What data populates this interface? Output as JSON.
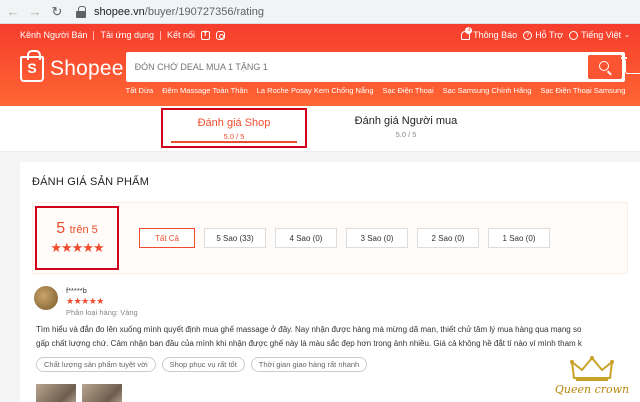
{
  "browser": {
    "domain": "shopee.vn",
    "path": "/buyer/190727356/rating"
  },
  "topbar": {
    "seller_center": "Kênh Người Bán",
    "download_app": "Tải ứng dụng",
    "connect": "Kết nối",
    "notifications": "Thông Báo",
    "notification_count": "3",
    "help": "Hỗ Trợ",
    "language": "Tiếng Việt"
  },
  "logo": {
    "brand": "Shopee",
    "mark": "S"
  },
  "search": {
    "placeholder": "ĐÓN CHỜ DEAL MUA 1 TẶNG 1",
    "suggestions": [
      "Tất Dừa",
      "Đệm Massage Toàn Thân",
      "La Roche Posay Kem Chống Nắng",
      "Sạc Điện Thoại",
      "Sạc Samsung Chính Hãng",
      "Sạc Điện Thoại Samsung"
    ]
  },
  "tabs": [
    {
      "label": "Đánh giá Shop",
      "score": "5.0 / 5"
    },
    {
      "label": "Đánh giá Người mua",
      "score": "5.0 / 5"
    }
  ],
  "section_title": "ĐÁNH GIÁ SẢN PHẨM",
  "overview": {
    "score": "5",
    "out_of": "trên 5",
    "stars": "★★★★★",
    "filters": [
      "Tất Cả",
      "5 Sao (33)",
      "4 Sao (0)",
      "3 Sao (0)",
      "2 Sao (0)",
      "1 Sao (0)"
    ]
  },
  "review": {
    "user": "f*****b",
    "stars": "★★★★★",
    "variant": "Phân loại hàng: Vàng",
    "text": "Tìm hiểu và đắn đo lên xuống mình quyết định mua ghế massage ở đây. Nay nhận được hàng mà mừng dã man, thiết chử tâm lý mua hàng qua mạng so gấp chất lượng chứ. Cảm nhận ban đầu của mình khi nhận được ghế này là màu sắc đẹp hơn trong ảnh nhiều. Giá cả không hề đắt tí nào ví mình tham k",
    "tags": [
      "Chất lượng sản phẩm tuyệt vời",
      "Shop phục vụ rất tốt",
      "Thời gian giao hàng rất nhanh"
    ]
  },
  "watermark": {
    "text": "Queen crown"
  }
}
